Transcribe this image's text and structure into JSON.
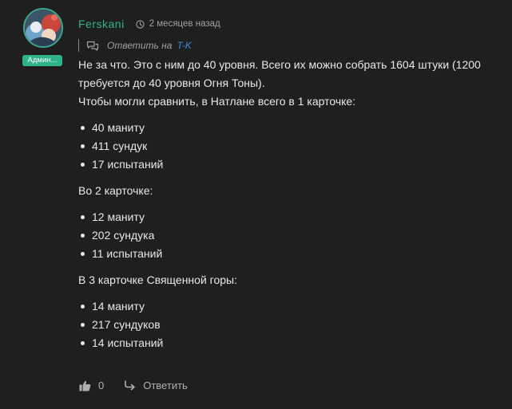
{
  "comment": {
    "author": "Ferskani",
    "role_badge": "Админ...",
    "time_ago": "2 месяцев назад",
    "reply_label": "Ответить на",
    "reply_target": "T-K",
    "paragraphs": [
      "Не за что. Это с ним до 40 уровня. Всего их можно собрать 1604 штуки (1200 требуется до 40 уровня Огня Тоны).",
      "Чтобы могли сравнить, в Натлане всего в 1 карточке:"
    ],
    "list1": [
      "40 маниту",
      "411 сундук",
      "17 испытаний"
    ],
    "section2_title": "Во 2 карточке:",
    "list2": [
      "12 маниту",
      "202 сундука",
      "11 испытаний"
    ],
    "section3_title": "В 3 карточке Священной горы:",
    "list3": [
      "14 маниту",
      "217 сундуков",
      "14 испытаний"
    ],
    "likes": "0",
    "reply_button": "Ответить"
  },
  "icons": {
    "clock": "clock-icon",
    "reply_to": "chat-bubbles-icon",
    "like": "thumbs-up-icon",
    "reply": "reply-arrow-icon"
  },
  "colors": {
    "background": "#1f1f1f",
    "accent": "#2fb38a",
    "link": "#3d8ad6",
    "muted": "#a0a0a0"
  }
}
